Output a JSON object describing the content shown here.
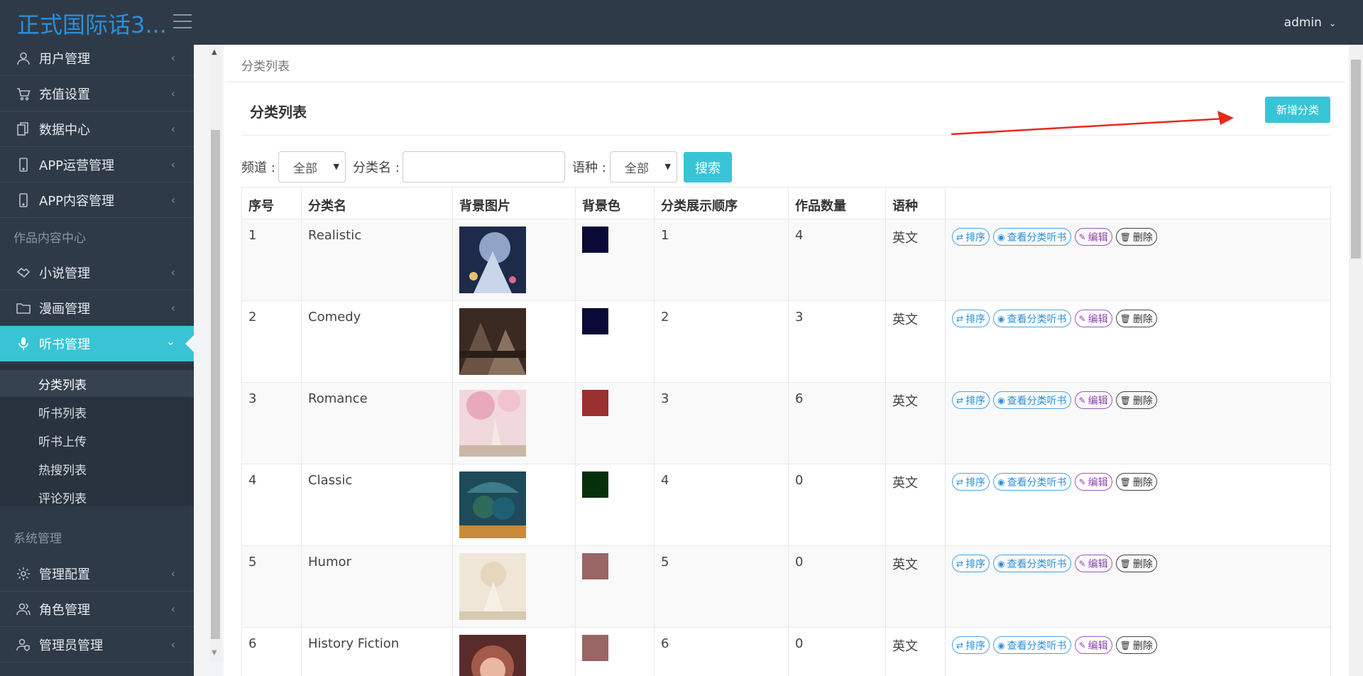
{
  "header": {
    "brand": "正式国际话3...",
    "user": "admin"
  },
  "sidebar": {
    "items": [
      {
        "label": "用户管理",
        "icon": "user-icon"
      },
      {
        "label": "充值设置",
        "icon": "cart-icon"
      },
      {
        "label": "数据中心",
        "icon": "copy-icon"
      },
      {
        "label": "APP运营管理",
        "icon": "mobile-icon"
      },
      {
        "label": "APP内容管理",
        "icon": "mobile-icon"
      }
    ],
    "section1": "作品内容中心",
    "items2": [
      {
        "label": "小说管理",
        "icon": "handshake-icon"
      },
      {
        "label": "漫画管理",
        "icon": "folder-icon"
      },
      {
        "label": "听书管理",
        "icon": "microphone-icon"
      }
    ],
    "sub_items": [
      "分类列表",
      "听书列表",
      "听书上传",
      "热搜列表",
      "评论列表"
    ],
    "section2": "系统管理",
    "items3": [
      {
        "label": "管理配置",
        "icon": "gear-icon"
      },
      {
        "label": "角色管理",
        "icon": "users-icon"
      },
      {
        "label": "管理员管理",
        "icon": "user-shield-icon"
      }
    ]
  },
  "breadcrumb": "分类列表",
  "panel": {
    "title": "分类列表",
    "add_button": "新增分类"
  },
  "filters": {
    "channel_label": "频道 :",
    "channel_value": "全部",
    "name_label": "分类名 :",
    "name_value": "",
    "lang_label": "语种 :",
    "lang_value": "全部",
    "search_button": "搜索"
  },
  "table": {
    "columns": [
      "序号",
      "分类名",
      "背景图片",
      "背景色",
      "分类展示顺序",
      "作品数量",
      "语种",
      ""
    ],
    "actions": {
      "sort": "排序",
      "view": "查看分类听书",
      "edit": "编辑",
      "delete": "删除"
    },
    "rows": [
      {
        "id": "1",
        "name": "Realistic",
        "color": "#0a0a38",
        "order": "1",
        "count": "4",
        "lang": "英文"
      },
      {
        "id": "2",
        "name": "Comedy",
        "color": "#0a0a38",
        "order": "2",
        "count": "3",
        "lang": "英文"
      },
      {
        "id": "3",
        "name": "Romance",
        "color": "#9a3030",
        "order": "3",
        "count": "6",
        "lang": "英文"
      },
      {
        "id": "4",
        "name": "Classic",
        "color": "#06300a",
        "order": "4",
        "count": "0",
        "lang": "英文"
      },
      {
        "id": "5",
        "name": "Humor",
        "color": "#9a6565",
        "order": "5",
        "count": "0",
        "lang": "英文"
      },
      {
        "id": "6",
        "name": "History Fiction",
        "color": "#9a6565",
        "order": "6",
        "count": "0",
        "lang": "英文"
      }
    ]
  }
}
